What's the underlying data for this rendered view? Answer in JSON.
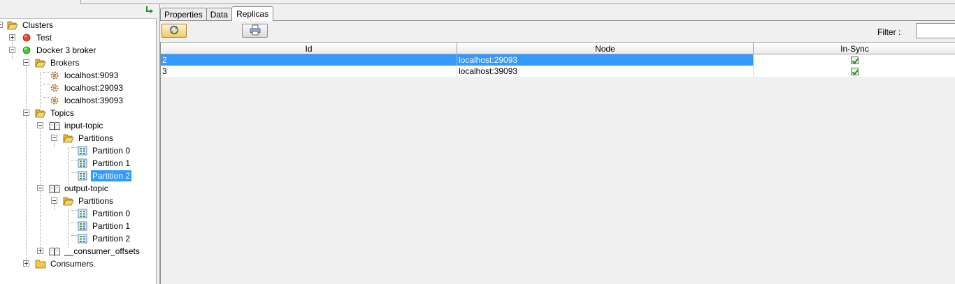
{
  "tree": {
    "nodes": [
      {
        "label": "Clusters",
        "icon": "folder-open-icon"
      },
      {
        "label": "Test",
        "icon": "status-red-icon"
      },
      {
        "label": "Docker 3 broker",
        "icon": "status-green-icon"
      },
      {
        "label": "Brokers",
        "icon": "folder-open-icon"
      },
      {
        "label": "localhost:9093",
        "icon": "broker-gear-icon"
      },
      {
        "label": "localhost:29093",
        "icon": "broker-gear-icon"
      },
      {
        "label": "localhost:39093",
        "icon": "broker-gear-icon"
      },
      {
        "label": "Topics",
        "icon": "folder-open-icon"
      },
      {
        "label": "input-topic",
        "icon": "topic-book-icon"
      },
      {
        "label": "Partitions",
        "icon": "folder-open-icon"
      },
      {
        "label": "Partition 0",
        "icon": "partition-grid-icon"
      },
      {
        "label": "Partition 1",
        "icon": "partition-grid-icon"
      },
      {
        "label": "Partition 2",
        "icon": "partition-grid-icon"
      },
      {
        "label": "output-topic",
        "icon": "topic-book-icon"
      },
      {
        "label": "Partitions",
        "icon": "folder-open-icon"
      },
      {
        "label": "Partition 0",
        "icon": "partition-grid-icon"
      },
      {
        "label": "Partition 1",
        "icon": "partition-grid-icon"
      },
      {
        "label": "Partition 2",
        "icon": "partition-grid-icon"
      },
      {
        "label": "__consumer_offsets",
        "icon": "topic-book-icon"
      },
      {
        "label": "Consumers",
        "icon": "folder-closed-icon"
      }
    ],
    "selected_label": "Partition 2"
  },
  "tabs": [
    "Properties",
    "Data",
    "Replicas"
  ],
  "active_tab": "Replicas",
  "toolbar": {
    "refresh_icon": "refresh-icon",
    "print_icon": "print-icon",
    "filter_label": "Filter :",
    "filter_value": ""
  },
  "table": {
    "columns": [
      "Id",
      "Node",
      "In-Sync"
    ],
    "rows": [
      {
        "id": "2",
        "node": "localhost:29093",
        "in_sync": true,
        "selected": true
      },
      {
        "id": "3",
        "node": "localhost:39093",
        "in_sync": true,
        "selected": false
      }
    ]
  },
  "colors": {
    "selection": "#3399ff",
    "status_red": "#e8442e",
    "status_green": "#4cc23a",
    "folder": "#f3c84b"
  }
}
